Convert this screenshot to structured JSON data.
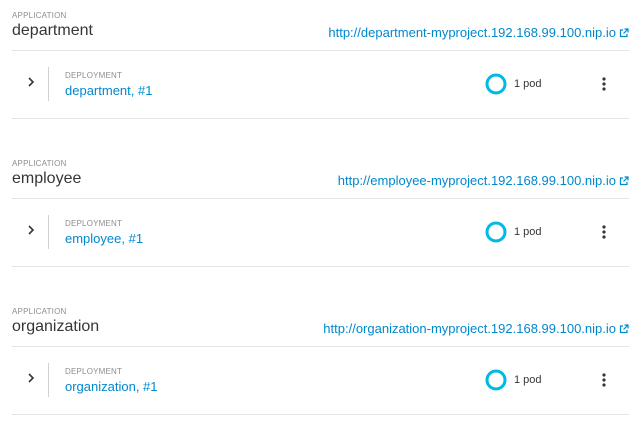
{
  "applications": [
    {
      "kicker": "APPLICATION",
      "name": "department",
      "route": "http://department-myproject.192.168.99.100.nip.io",
      "deployment": {
        "kicker": "DEPLOYMENT",
        "name": "department, #1",
        "pods": "1 pod",
        "pod_ring_color": "#00b9e4",
        "expanded": false
      }
    },
    {
      "kicker": "APPLICATION",
      "name": "employee",
      "route": "http://employee-myproject.192.168.99.100.nip.io",
      "deployment": {
        "kicker": "DEPLOYMENT",
        "name": "employee, #1",
        "pods": "1 pod",
        "pod_ring_color": "#00b9e4",
        "expanded": false
      }
    },
    {
      "kicker": "APPLICATION",
      "name": "organization",
      "route": "http://organization-myproject.192.168.99.100.nip.io",
      "deployment": {
        "kicker": "DEPLOYMENT",
        "name": "organization, #1",
        "pods": "1 pod",
        "pod_ring_color": "#00b9e4",
        "expanded": false
      }
    }
  ],
  "icons": {
    "expand": "chevron-right-icon",
    "route_link": "external-link-icon",
    "pod_status": "pod-donut-icon",
    "actions": "kebab-menu-icon"
  },
  "colors": {
    "link": "#0088ce",
    "pod_ring": "#00b9e4",
    "muted_text": "#8b8d8f",
    "divider": "#e4e4e4"
  }
}
